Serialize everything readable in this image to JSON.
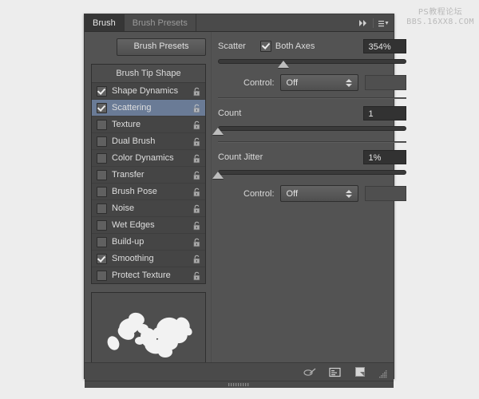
{
  "watermark": {
    "line1": "PS教程论坛",
    "line2": "BBS.16XX8.COM"
  },
  "panel": {
    "tabs": [
      {
        "label": "Brush",
        "active": true
      },
      {
        "label": "Brush Presets",
        "active": false
      }
    ],
    "collapse_icon": "double-chevron-right-icon",
    "menu_icon": "panel-menu-icon"
  },
  "left": {
    "presets_button": "Brush Presets",
    "list_header": "Brush Tip Shape",
    "items": [
      {
        "label": "Shape Dynamics",
        "checked": true,
        "selected": false,
        "lock": "unlocked-icon"
      },
      {
        "label": "Scattering",
        "checked": true,
        "selected": true,
        "lock": "unlocked-icon"
      },
      {
        "label": "Texture",
        "checked": false,
        "selected": false,
        "lock": "unlocked-icon"
      },
      {
        "label": "Dual Brush",
        "checked": false,
        "selected": false,
        "lock": "unlocked-icon"
      },
      {
        "label": "Color Dynamics",
        "checked": false,
        "selected": false,
        "lock": "unlocked-icon"
      },
      {
        "label": "Transfer",
        "checked": false,
        "selected": false,
        "lock": "unlocked-icon"
      },
      {
        "label": "Brush Pose",
        "checked": false,
        "selected": false,
        "lock": "unlocked-icon"
      },
      {
        "label": "Noise",
        "checked": false,
        "selected": false,
        "lock": "unlocked-icon"
      },
      {
        "label": "Wet Edges",
        "checked": false,
        "selected": false,
        "lock": "unlocked-icon"
      },
      {
        "label": "Build-up",
        "checked": false,
        "selected": false,
        "lock": "unlocked-icon"
      },
      {
        "label": "Smoothing",
        "checked": true,
        "selected": false,
        "lock": "unlocked-icon"
      },
      {
        "label": "Protect Texture",
        "checked": false,
        "selected": false,
        "lock": "unlocked-icon"
      }
    ],
    "preview_name": "brush-stroke-preview"
  },
  "right": {
    "scatter": {
      "label": "Scatter",
      "both_axes_label": "Both Axes",
      "both_axes_checked": true,
      "value": "354%",
      "slider_percent": 35
    },
    "scatter_control": {
      "label": "Control:",
      "value": "Off",
      "options": [
        "Off"
      ],
      "side_field": ""
    },
    "count": {
      "label": "Count",
      "value": "1",
      "slider_percent": 0
    },
    "count_jitter": {
      "label": "Count Jitter",
      "value": "1%",
      "slider_percent": 0
    },
    "jitter_control": {
      "label": "Control:",
      "value": "Off",
      "options": [
        "Off"
      ],
      "side_field": ""
    }
  },
  "footer": {
    "icons": [
      {
        "name": "toggle-brush-dirty-icon"
      },
      {
        "name": "new-preset-icon"
      },
      {
        "name": "create-new-brush-icon"
      }
    ],
    "resize_grip": "resize-grip-icon"
  },
  "colors": {
    "panel_bg": "#535353",
    "list_bg": "#454545",
    "selection": "#6a7b96",
    "field_bg": "#323232",
    "text": "#dedede"
  }
}
